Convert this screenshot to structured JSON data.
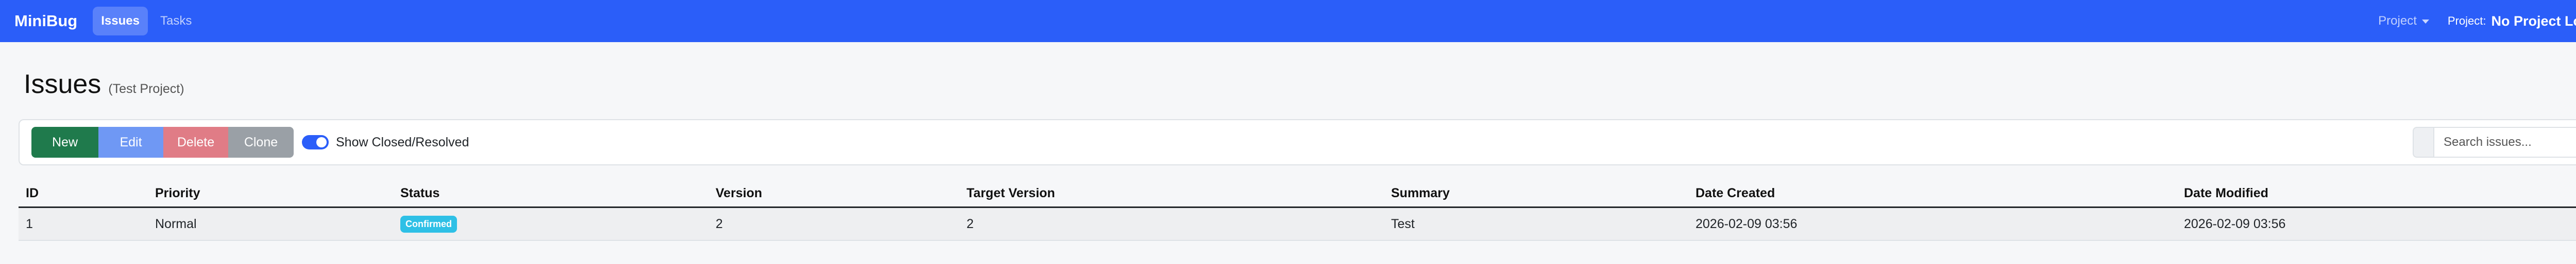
{
  "navbar": {
    "brand": "MiniBug",
    "links": [
      {
        "label": "Issues",
        "active": true
      },
      {
        "label": "Tasks",
        "active": false
      }
    ],
    "project_dropdown": "Project",
    "project_label": "Project:",
    "project_value": "No Project Loaded"
  },
  "page": {
    "title": "Issues",
    "subtitle": "(Test Project)"
  },
  "toolbar": {
    "new_label": "New",
    "edit_label": "Edit",
    "delete_label": "Delete",
    "clone_label": "Clone",
    "toggle_label": "Show Closed/Resolved",
    "toggle_on": true,
    "search_placeholder": "Search issues..."
  },
  "table": {
    "columns": [
      "ID",
      "Priority",
      "Status",
      "Version",
      "Target Version",
      "Summary",
      "Date Created",
      "Date Modified"
    ],
    "rows": [
      {
        "id": "1",
        "priority": "Normal",
        "status": "Confirmed",
        "version": "2",
        "target_version": "2",
        "summary": "Test",
        "date_created": "2026-02-09 03:56",
        "date_modified": "2026-02-09 03:56"
      }
    ]
  },
  "colors": {
    "navbar": "#2b5ef9",
    "new": "#1f7a4c",
    "edit": "#6f98f4",
    "delete": "#e07c86",
    "clone": "#9aa0a6",
    "status_confirmed": "#2ec0e6"
  }
}
